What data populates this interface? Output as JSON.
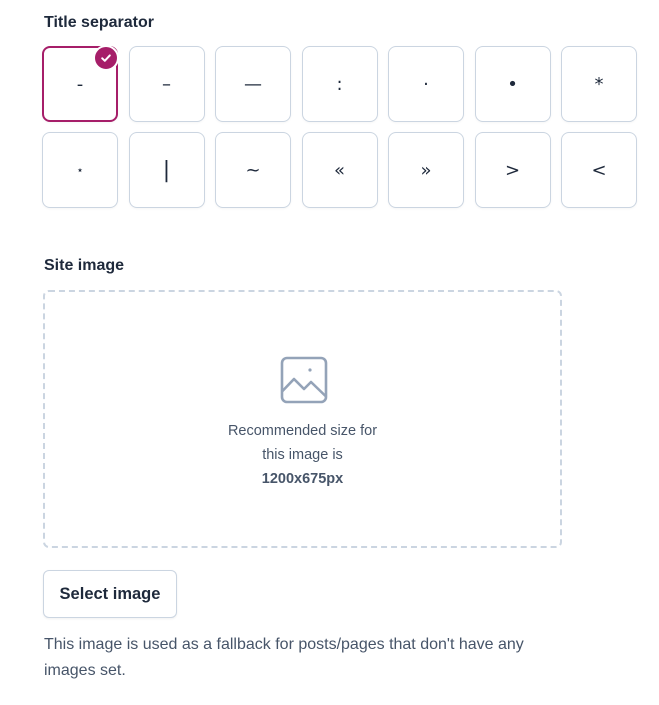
{
  "title_separator": {
    "label": "Title separator",
    "selected_index": 0,
    "options": [
      "-",
      "–",
      "—",
      ":",
      "·",
      "•",
      "*",
      "⋆",
      "|",
      "~",
      "«",
      "»",
      ">",
      "<"
    ]
  },
  "site_image": {
    "label": "Site image",
    "dropzone": {
      "line1": "Recommended size for",
      "line2": "this image is",
      "size": "1200x675px"
    },
    "select_button_label": "Select image",
    "help_text": "This image is used as a fallback for posts/pages that don't have any images set."
  },
  "colors": {
    "accent": "#a61e69",
    "border": "#cbd5e1",
    "text": "#1e293b",
    "muted_text": "#475569",
    "icon": "#94a3b8"
  },
  "icons": {
    "selected_badge": "check-circle-icon",
    "image_placeholder": "image-icon"
  }
}
